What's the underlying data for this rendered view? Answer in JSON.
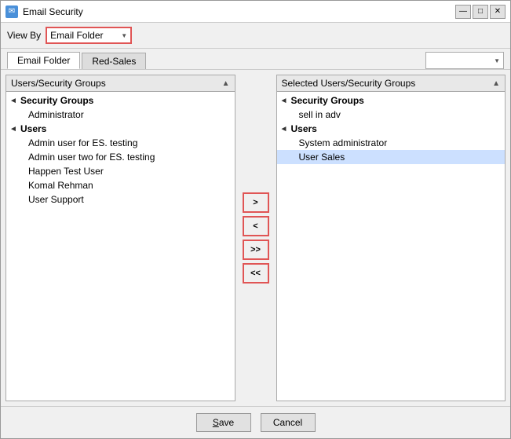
{
  "window": {
    "title": "Email Security",
    "icon": "✉"
  },
  "toolbar": {
    "view_by_label": "View By",
    "dropdown_value": "Email Folder"
  },
  "tabs": [
    {
      "label": "Email Folder",
      "active": true
    },
    {
      "label": "Red-Sales",
      "active": false
    }
  ],
  "tab_dropdown": "",
  "left_panel": {
    "header": "Users/Security Groups",
    "security_groups_label": "Security Groups",
    "security_groups_items": [
      "Administrator"
    ],
    "users_label": "Users",
    "users_items": [
      {
        "label": "Admin user for ES. testing",
        "selected": false
      },
      {
        "label": "Admin user two for ES. testing",
        "selected": false
      },
      {
        "label": "Happen Test User",
        "selected": false
      },
      {
        "label": "Komal Rehman",
        "selected": false
      },
      {
        "label": "User Support",
        "selected": false
      }
    ]
  },
  "right_panel": {
    "header": "Selected Users/Security Groups",
    "security_groups_label": "Security Groups",
    "security_groups_items": [
      "sell in adv"
    ],
    "users_label": "Users",
    "users_items": [
      {
        "label": "System administrator",
        "selected": false
      },
      {
        "label": "User Sales",
        "selected": true
      }
    ]
  },
  "transfer_buttons": {
    "move_right": ">",
    "move_left": "<",
    "move_all_right": ">>",
    "move_all_left": "<<"
  },
  "footer": {
    "save_label": "Save",
    "cancel_label": "Cancel"
  },
  "title_controls": {
    "minimize": "—",
    "maximize": "□",
    "close": "✕"
  }
}
